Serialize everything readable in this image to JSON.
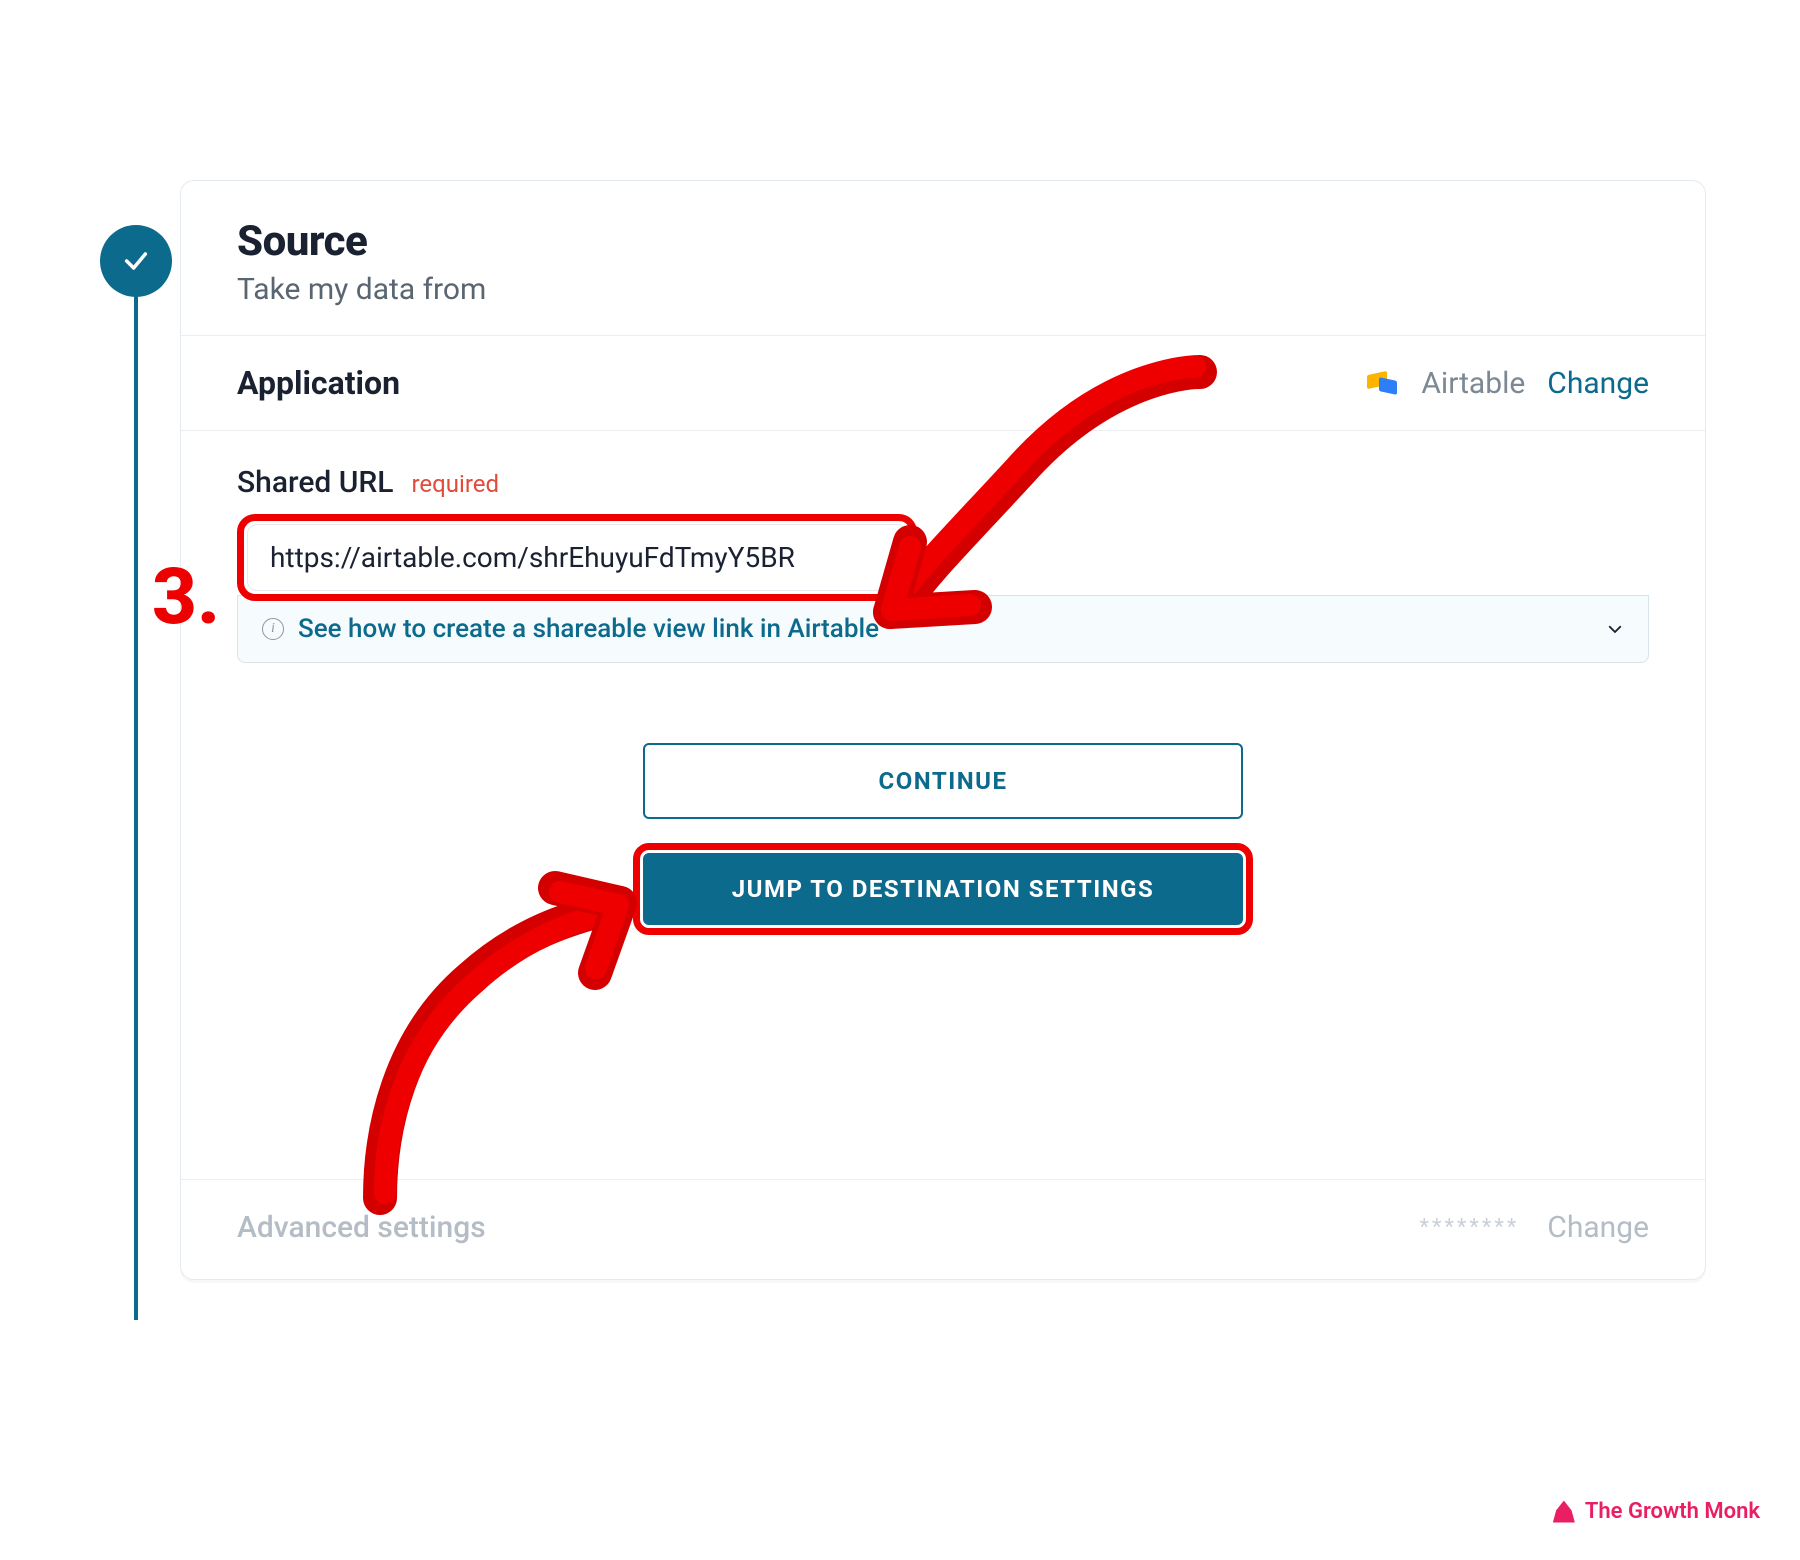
{
  "annotation": {
    "step_number": "3."
  },
  "header": {
    "title": "Source",
    "subtitle": "Take my data from"
  },
  "application_row": {
    "label": "Application",
    "selected_app": "Airtable",
    "change_link": "Change"
  },
  "shared_url": {
    "label": "Shared URL",
    "required_text": "required",
    "value": "https://airtable.com/shrEhuyuFdTmyY5BR",
    "help_text": "See how to create a shareable view link in Airtable"
  },
  "buttons": {
    "continue": "CONTINUE",
    "jump": "JUMP TO DESTINATION SETTINGS"
  },
  "advanced": {
    "label": "Advanced settings",
    "masked": "********",
    "change_link": "Change"
  },
  "watermark": {
    "text": "The Growth Monk"
  },
  "colors": {
    "accent": "#0c6a8c",
    "annotation_red": "#ef0000",
    "brand_pink": "#e91e63"
  }
}
